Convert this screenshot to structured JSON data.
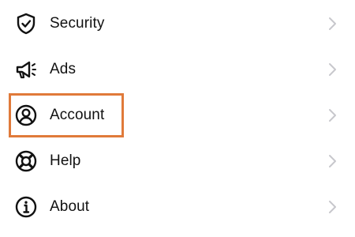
{
  "settings_menu": {
    "items": [
      {
        "label": "Security",
        "icon": "shield-check-icon"
      },
      {
        "label": "Ads",
        "icon": "megaphone-icon"
      },
      {
        "label": "Account",
        "icon": "person-circle-icon"
      },
      {
        "label": "Help",
        "icon": "lifebuoy-icon"
      },
      {
        "label": "About",
        "icon": "info-circle-icon"
      }
    ],
    "highlighted_item": "Account",
    "highlight_color": "#e07a3a",
    "chevron_color": "#c7c7cc"
  }
}
